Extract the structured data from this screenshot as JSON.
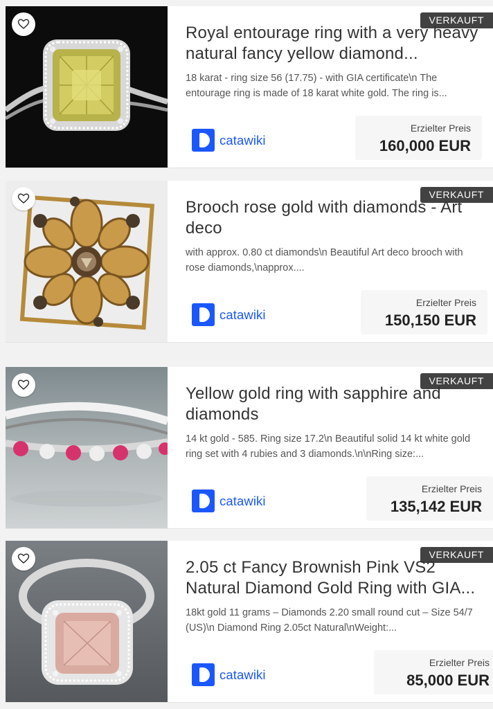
{
  "listings": [
    {
      "badge": "VERKAUFT",
      "title": "Royal entourage ring with a very heavy natural fancy yellow diamond...",
      "description": "18 karat - ring size 56 (17.75) - with GIA certificate\\n The entourage ring is made of 18 karat white gold. The ring is...",
      "brand": "catawiki",
      "price_label": "Erzielter Preis",
      "price": "160,000 EUR"
    },
    {
      "badge": "VERKAUFT",
      "title": "Brooch rose gold with diamonds - Art deco",
      "description": "with approx. 0.80 ct diamonds\\n Beautiful Art deco brooch with rose diamonds,\\napprox....",
      "brand": "catawiki",
      "price_label": "Erzielter Preis",
      "price": "150,150 EUR"
    },
    {
      "badge": "VERKAUFT",
      "title": "Yellow gold ring with sapphire and diamonds",
      "description": "14 kt gold - 585. Ring size 17.2\\n Beautiful solid 14 kt white gold ring set with 4 rubies and 3 diamonds.\\n\\nRing size:...",
      "brand": "catawiki",
      "price_label": "Erzielter Preis",
      "price": "135,142 EUR"
    },
    {
      "badge": "VERKAUFT",
      "title": "2.05 ct Fancy Brownish Pink VS2 Natural Diamond Gold Ring with GIA...",
      "description": "18kt gold 11 grams – Diamonds 2.20 small round cut – Size 54/7 (US)\\n Diamond Ring 2.05ct Natural\\nWeight:...",
      "brand": "catawiki",
      "price_label": "Erzielter Preis",
      "price": "85,000 EUR"
    }
  ],
  "colors": {
    "brand_blue": "#1a57ff",
    "badge_bg": "#2a2a2a",
    "title_text": "#333333"
  },
  "icons": {
    "favorite": "heart-outline-icon",
    "brand": "catawiki-logo-icon"
  }
}
